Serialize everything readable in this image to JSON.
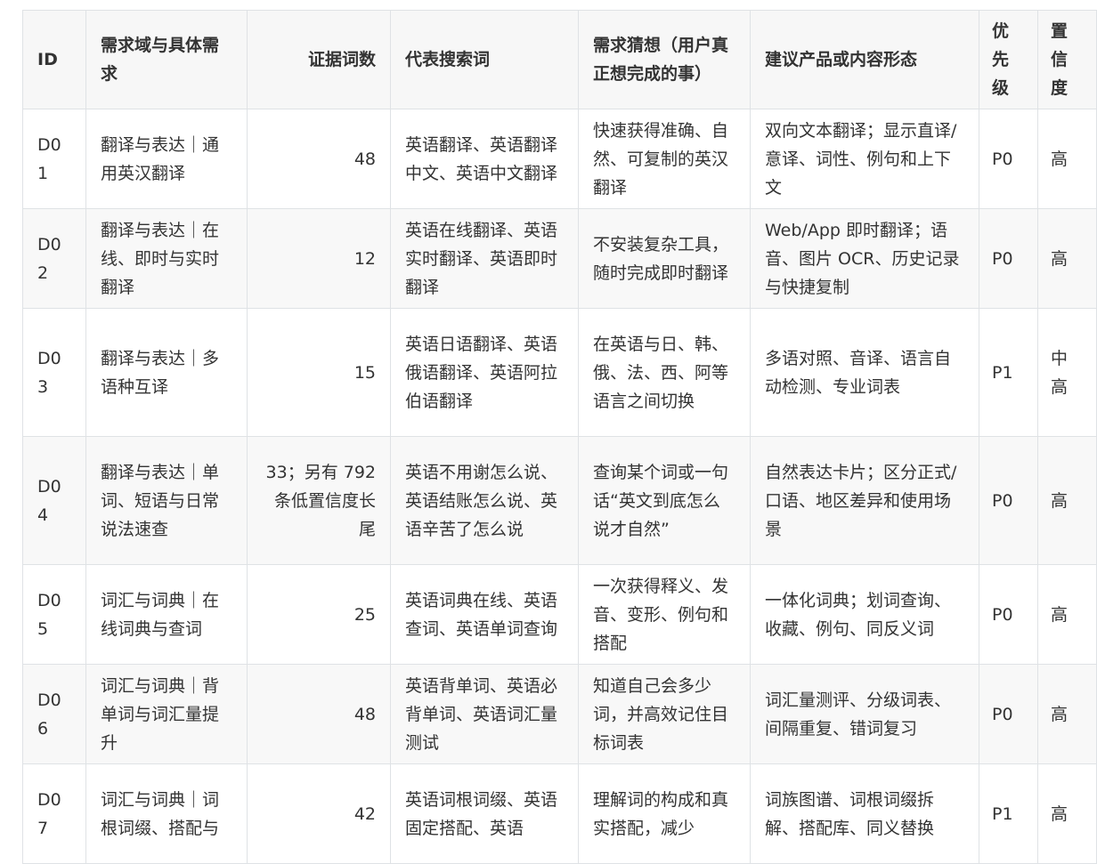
{
  "table": {
    "headers": {
      "id": "ID",
      "domain": "需求域与具体需求",
      "evidence": "证据词数",
      "keywords": "代表搜索词",
      "guess": "需求猜想（用户真正想完成的事）",
      "product": "建议产品或内容形态",
      "priority": "优先级",
      "confidence": "置信度"
    },
    "rows": [
      {
        "id": "D01",
        "domain": "翻译与表达｜通用英汉翻译",
        "evidence": "48",
        "keywords": "英语翻译、英语翻译中文、英语中文翻译",
        "guess": "快速获得准确、自然、可复制的英汉翻译",
        "product": "双向文本翻译；显示直译/意译、词性、例句和上下文",
        "priority": "P0",
        "confidence": "高"
      },
      {
        "id": "D02",
        "domain": "翻译与表达｜在线、即时与实时翻译",
        "evidence": "12",
        "keywords": "英语在线翻译、英语实时翻译、英语即时翻译",
        "guess": "不安装复杂工具，随时完成即时翻译",
        "product": "Web/App 即时翻译；语音、图片 OCR、历史记录与快捷复制",
        "priority": "P0",
        "confidence": "高"
      },
      {
        "id": "D03",
        "domain": "翻译与表达｜多语种互译",
        "evidence": "15",
        "keywords": "英语日语翻译、英语俄语翻译、英语阿拉伯语翻译",
        "guess": "在英语与日、韩、俄、法、西、阿等语言之间切换",
        "product": "多语对照、音译、语言自动检测、专业词表",
        "priority": "P1",
        "confidence": "中高"
      },
      {
        "id": "D04",
        "domain": "翻译与表达｜单词、短语与日常说法速查",
        "evidence": "33；另有 792 条低置信度长尾",
        "keywords": "英语不用谢怎么说、英语结账怎么说、英语辛苦了怎么说",
        "guess": "查询某个词或一句话“英文到底怎么说才自然”",
        "product": "自然表达卡片；区分正式/口语、地区差异和使用场景",
        "priority": "P0",
        "confidence": "高"
      },
      {
        "id": "D05",
        "domain": "词汇与词典｜在线词典与查词",
        "evidence": "25",
        "keywords": "英语词典在线、英语查词、英语单词查询",
        "guess": "一次获得释义、发音、变形、例句和搭配",
        "product": "一体化词典；划词查询、收藏、例句、同反义词",
        "priority": "P0",
        "confidence": "高"
      },
      {
        "id": "D06",
        "domain": "词汇与词典｜背单词与词汇量提升",
        "evidence": "48",
        "keywords": "英语背单词、英语必背单词、英语词汇量测试",
        "guess": "知道自己会多少词，并高效记住目标词表",
        "product": "词汇量测评、分级词表、间隔重复、错词复习",
        "priority": "P0",
        "confidence": "高"
      },
      {
        "id": "D07",
        "domain": "词汇与词典｜词根词缀、搭配与",
        "evidence": "42",
        "keywords": "英语词根词缀、英语固定搭配、英语",
        "guess": "理解词的构成和真实搭配，减少",
        "product": "词族图谱、词根词缀拆解、搭配库、同义替换",
        "priority": "P1",
        "confidence": "高"
      }
    ]
  }
}
